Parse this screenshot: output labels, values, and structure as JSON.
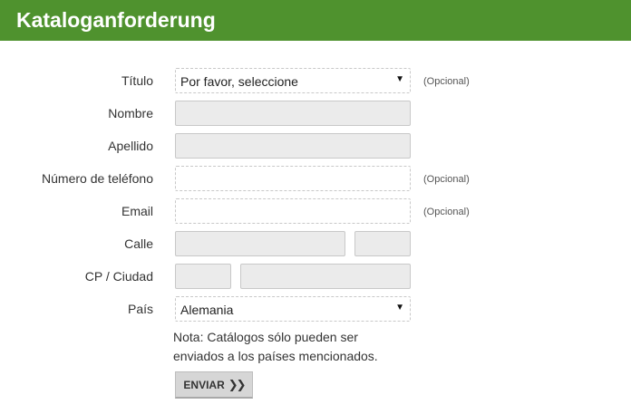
{
  "header": {
    "title": "Kataloganforderung"
  },
  "form": {
    "titulo": {
      "label": "Título",
      "selected": "Por favor, seleccione",
      "optional_note": "(Opcional)"
    },
    "nombre": {
      "label": "Nombre",
      "value": ""
    },
    "apellido": {
      "label": "Apellido",
      "value": ""
    },
    "telefono": {
      "label": "Número de teléfono",
      "value": "",
      "optional_note": "(Opcional)"
    },
    "email": {
      "label": "Email",
      "value": "",
      "optional_note": "(Opcional)"
    },
    "calle": {
      "label": "Calle",
      "street": "",
      "number": ""
    },
    "cp_ciudad": {
      "label": "CP / Ciudad",
      "cp": "",
      "ciudad": ""
    },
    "pais": {
      "label": "País",
      "selected": "Alemania"
    },
    "note": "Nota: Catálogos sólo pueden ser enviados a los países mencionados.",
    "submit_label": "ENVIAR"
  },
  "icons": {
    "select_arrow": "triangle-down-icon",
    "submit_arrow": "double-chevron-right-icon"
  },
  "colors": {
    "header_bg": "#4f922e",
    "required_field_bg": "#ebebeb",
    "button_bg": "#d6d6d6"
  }
}
